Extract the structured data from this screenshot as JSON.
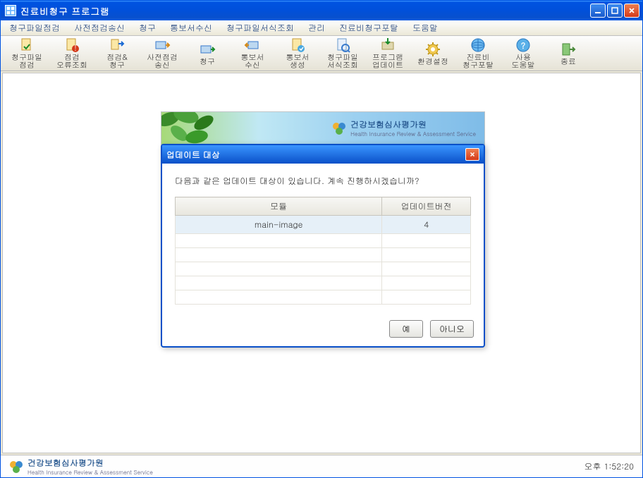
{
  "window": {
    "title": "진료비청구 프로그램"
  },
  "menubar": {
    "items": [
      "청구파일점검",
      "사전점검송신",
      "청구",
      "통보서수신",
      "청구파일서식조회",
      "관리",
      "진료비청구포탈",
      "도움말"
    ]
  },
  "toolbar": {
    "items": [
      {
        "label": "청구파일\n점검",
        "icon": "file-check"
      },
      {
        "label": "점검\n오류조회",
        "icon": "file-error"
      },
      {
        "label": "점검&\n청구",
        "icon": "file-send"
      },
      {
        "label": "사전점검\n송신",
        "icon": "precheck-send"
      },
      {
        "label": "청구",
        "icon": "claim"
      },
      {
        "label": "통보서\n수신",
        "icon": "notice-recv"
      },
      {
        "label": "통보서\n생성",
        "icon": "notice-gen"
      },
      {
        "label": "청구파일\n서식조회",
        "icon": "file-form"
      },
      {
        "label": "프로그램\n업데이트",
        "icon": "program-update"
      },
      {
        "label": "환경설정",
        "icon": "settings"
      },
      {
        "label": "진료비\n청구포탈",
        "icon": "portal"
      },
      {
        "label": "사용\n도움말",
        "icon": "help"
      },
      {
        "label": "종료",
        "icon": "exit"
      }
    ]
  },
  "banner": {
    "brand": "건강보험심사평가원",
    "brand_sub": "Health Insurance Review & Assessment Service"
  },
  "dialog": {
    "title": "업데이트 대상",
    "message": "다음과 같은 업데이트 대상이 있습니다. 계속 진행하시겠습니까?",
    "columns": {
      "module": "모듈",
      "version": "업데이트버전"
    },
    "rows": [
      {
        "module": "main-image",
        "version": "4"
      },
      {
        "module": "",
        "version": ""
      },
      {
        "module": "",
        "version": ""
      },
      {
        "module": "",
        "version": ""
      },
      {
        "module": "",
        "version": ""
      },
      {
        "module": "",
        "version": ""
      }
    ],
    "yes": "예",
    "no": "아니오"
  },
  "statusbar": {
    "brand": "건강보험심사평가원",
    "brand_sub": "Health Insurance Review & Assessment Service",
    "time": "오후 1:52:20"
  }
}
